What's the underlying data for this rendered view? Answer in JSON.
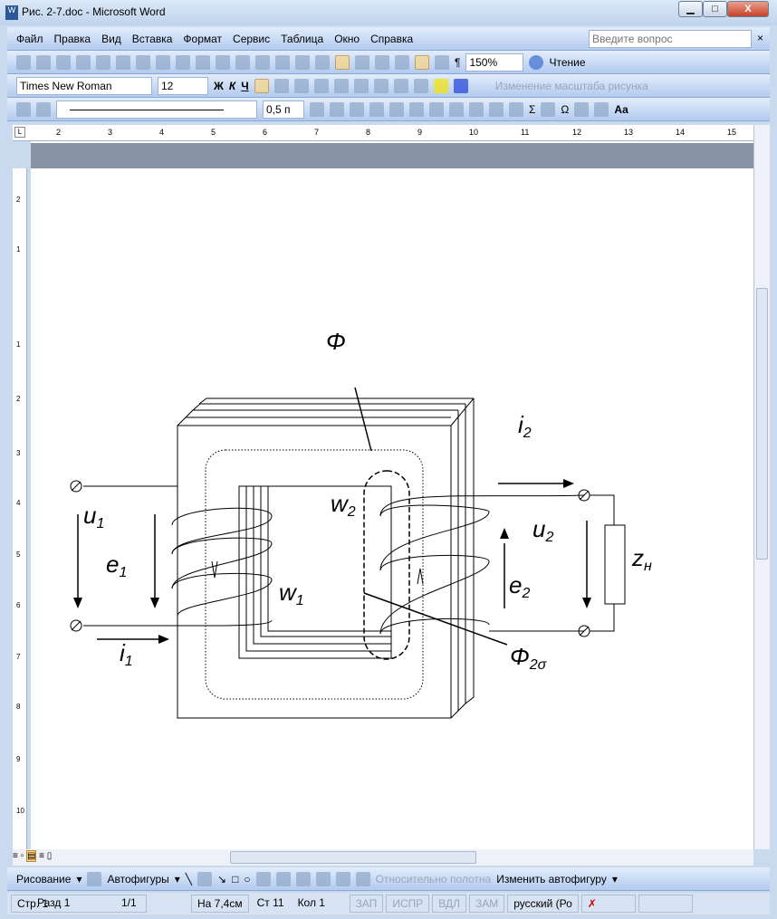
{
  "window": {
    "title": "Рис. 2-7.doc - Microsoft Word",
    "minimize": "▁",
    "maximize": "□",
    "close": "X"
  },
  "menu": {
    "items": [
      "Файл",
      "Правка",
      "Вид",
      "Вставка",
      "Формат",
      "Сервис",
      "Таблица",
      "Окно",
      "Справка"
    ],
    "help_placeholder": "Введите вопрос"
  },
  "standard": {
    "zoom": "150%",
    "reading": "Чтение",
    "pilcrow": "¶"
  },
  "formatting": {
    "font": "Times New Roman",
    "size": "12",
    "bold": "Ж",
    "italic": "К",
    "underline": "Ч",
    "picture_scale": "Изменение масштаба рисунка"
  },
  "drawing_props": {
    "line_weight": "0,5 п",
    "sum": "Σ",
    "omega": "Ω",
    "aa": "Aa"
  },
  "ruler": {
    "h": [
      "2",
      "3",
      "4",
      "5",
      "6",
      "7",
      "8",
      "9",
      "10",
      "11",
      "12",
      "13",
      "14",
      "15"
    ],
    "v": [
      "2",
      "1",
      "1",
      "2",
      "3",
      "4",
      "5",
      "6",
      "7",
      "8",
      "9",
      "10"
    ]
  },
  "diagram": {
    "phi": "Φ",
    "i2": "i",
    "i2_sub": "2",
    "w2": "w",
    "w2_sub": "2",
    "u1": "u",
    "u1_sub": "1",
    "e1": "e",
    "e1_sub": "1",
    "u2": "u",
    "u2_sub": "2",
    "e2": "e",
    "e2_sub": "2",
    "zn": "z",
    "zn_sub": "н",
    "w1": "w",
    "w1_sub": "1",
    "i1": "i",
    "i1_sub": "1",
    "phi2s": "Φ",
    "phi2s_sub": "2σ"
  },
  "draw_toolbar": {
    "draw": "Рисование",
    "autoshapes": "Автофигуры",
    "relative": "Относительно полотна",
    "change_shape": "Изменить автофигуру"
  },
  "status": {
    "page": "Стр. 1",
    "section": "Разд 1",
    "pages": "1/1",
    "at": "На 7,4см",
    "line": "Ст 11",
    "col": "Кол 1",
    "rec": "ЗАП",
    "trk": "ИСПР",
    "ext": "ВДЛ",
    "ovr": "ЗАМ",
    "lang": "русский (Ро"
  }
}
